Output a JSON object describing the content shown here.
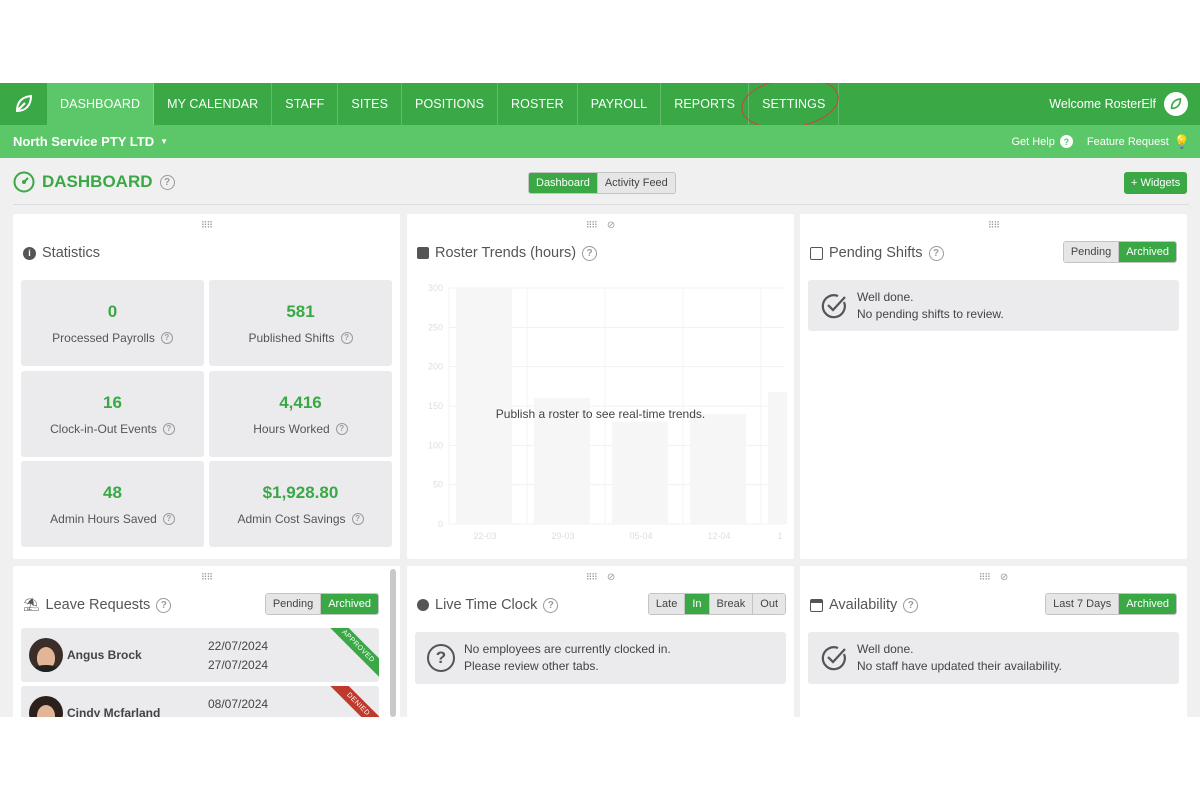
{
  "nav": {
    "items": [
      "DASHBOARD",
      "MY CALENDAR",
      "STAFF",
      "SITES",
      "POSITIONS",
      "ROSTER",
      "PAYROLL",
      "REPORTS",
      "SETTINGS"
    ],
    "welcome": "Welcome RosterElf"
  },
  "subnav": {
    "company": "North Service PTY LTD",
    "get_help": "Get Help",
    "feature_request": "Feature Request"
  },
  "page": {
    "title": "DASHBOARD",
    "toggle": [
      "Dashboard",
      "Activity Feed"
    ],
    "widgets_button": "+ Widgets"
  },
  "statistics": {
    "title": "Statistics",
    "items": [
      {
        "value": "0",
        "label": "Processed Payrolls"
      },
      {
        "value": "581",
        "label": "Published Shifts"
      },
      {
        "value": "16",
        "label": "Clock-in-Out Events"
      },
      {
        "value": "4,416",
        "label": "Hours Worked"
      },
      {
        "value": "48",
        "label": "Admin Hours Saved"
      },
      {
        "value": "$1,928.80",
        "label": "Admin Cost Savings"
      }
    ]
  },
  "roster_trends": {
    "title": "Roster Trends (hours)",
    "message": "Publish a roster to see real-time trends.",
    "y_ticks": [
      "300",
      "250",
      "200",
      "150",
      "100",
      "50",
      "0"
    ],
    "x_ticks": [
      "22-03",
      "29-03",
      "05-04",
      "12-04",
      "1"
    ],
    "bar_values": [
      300,
      160,
      130,
      140,
      168
    ]
  },
  "pending_shifts": {
    "title": "Pending Shifts",
    "toggle": [
      "Pending",
      "Archived"
    ],
    "line1": "Well done.",
    "line2": "No pending shifts to review."
  },
  "leave_requests": {
    "title": "Leave Requests",
    "toggle": [
      "Pending",
      "Archived"
    ],
    "rows": [
      {
        "name": "Angus Brock",
        "from": "22/07/2024",
        "to": "27/07/2024",
        "status": "APPROVED",
        "status_color": "#3aa845"
      },
      {
        "name": "Cindy Mcfarland",
        "from": "08/07/2024",
        "to": "",
        "status": "DENIED",
        "status_color": "#c0392b"
      }
    ]
  },
  "live_time_clock": {
    "title": "Live Time Clock",
    "toggle": [
      "Late",
      "In",
      "Break",
      "Out"
    ],
    "line1": "No employees are currently clocked in.",
    "line2": "Please review other tabs."
  },
  "availability": {
    "title": "Availability",
    "toggle": [
      "Last 7 Days",
      "Archived"
    ],
    "line1": "Well done.",
    "line2": "No staff have updated their availability."
  },
  "colors": {
    "brand": "#3aa845",
    "brand_light": "#5cc768",
    "annotation": "#d63d3d"
  }
}
